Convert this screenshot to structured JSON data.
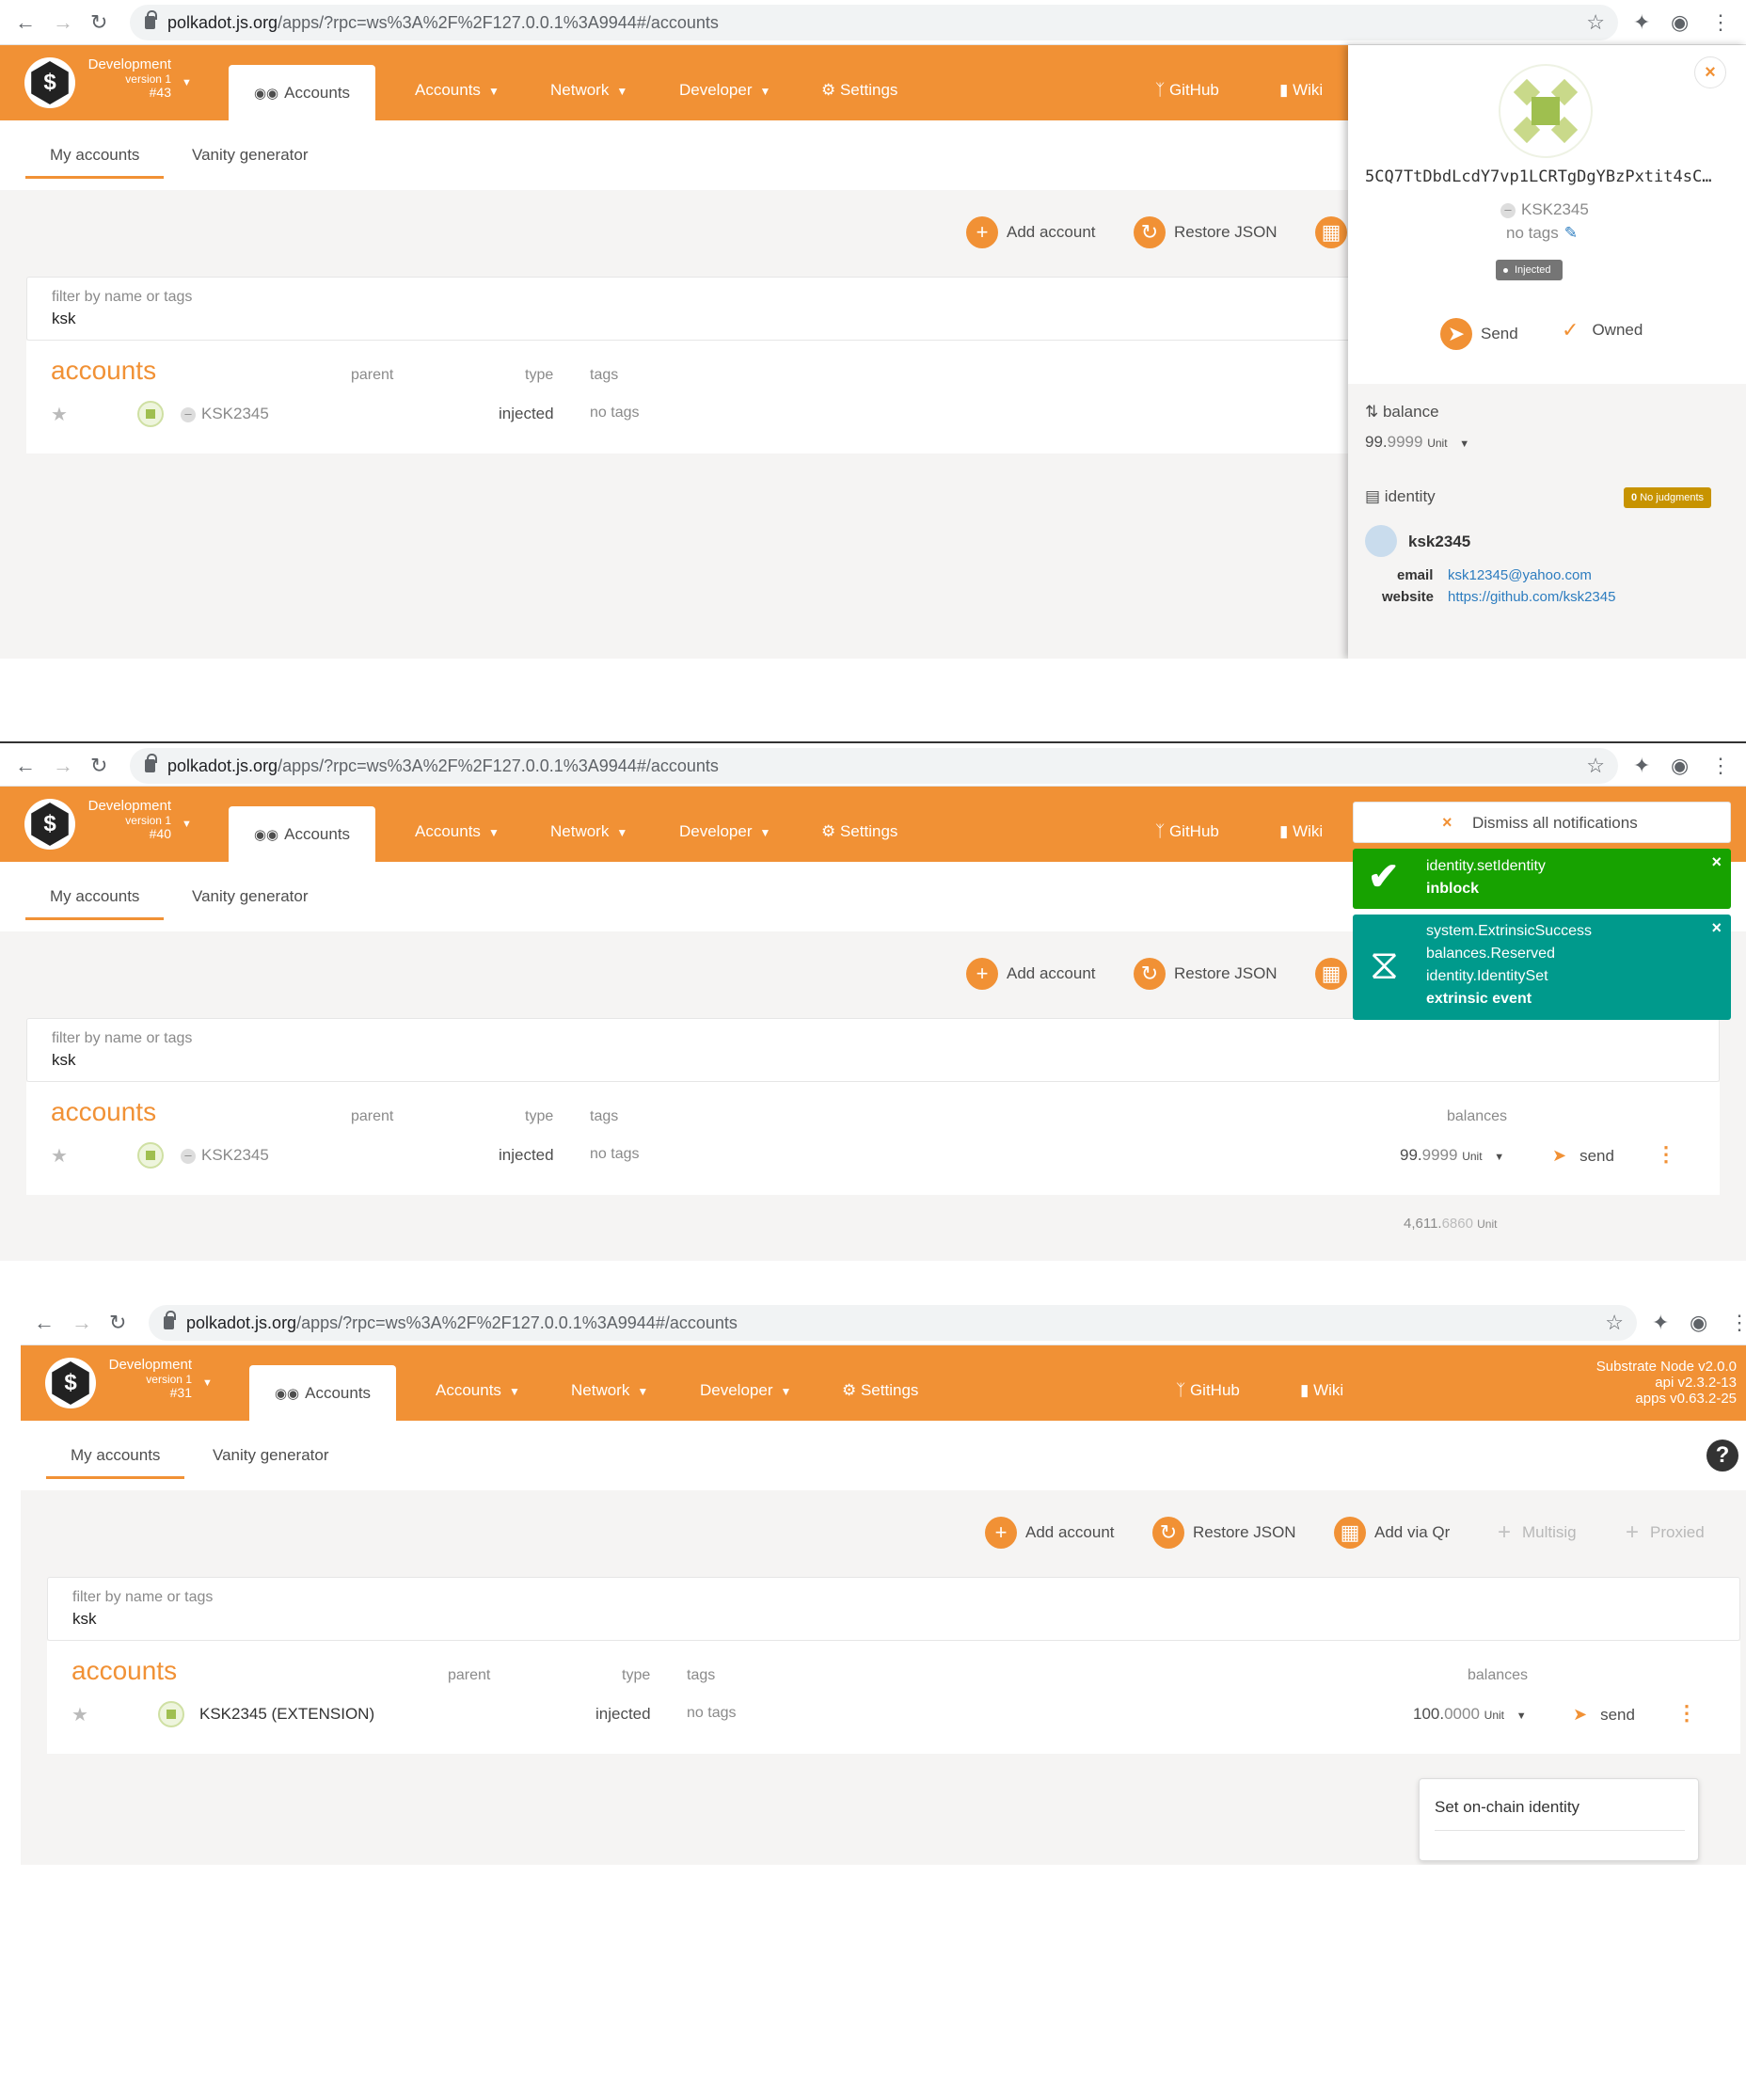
{
  "browser": {
    "url_host": "polkadot.js.org",
    "url_path": "/apps/?rpc=ws%3A%2F%2F127.0.0.1%3A9944#/accounts"
  },
  "nav": {
    "chain_name": "Development",
    "chain_version": "version 1",
    "tab_accounts": "Accounts",
    "menu_accounts": "Accounts",
    "menu_network": "Network",
    "menu_developer": "Developer",
    "menu_settings": "Settings",
    "menu_github": "GitHub",
    "menu_wiki": "Wiki"
  },
  "subtabs": {
    "my_accounts": "My accounts",
    "vanity": "Vanity generator"
  },
  "actions": {
    "add_account": "Add account",
    "restore_json": "Restore JSON",
    "add_via_qr": "Add via Qr",
    "multisig": "Multisig",
    "proxied": "Proxied"
  },
  "filter": {
    "label": "filter by name or tags",
    "value": "ksk"
  },
  "table": {
    "title": "accounts",
    "col_parent": "parent",
    "col_type": "type",
    "col_tags": "tags",
    "col_balances": "balances"
  },
  "panel1": {
    "block": "#43",
    "row": {
      "name": "KSK2345",
      "type": "injected",
      "tags": "no tags"
    },
    "sidebar": {
      "address": "5CQ7TtDbdLcdY7vp1LCRTgDgYBzPxtit4sC…",
      "name": "KSK2345",
      "tags": "no tags",
      "badge": "Injected",
      "send": "Send",
      "owned": "Owned",
      "balance_label": "balance",
      "balance_int": "99.",
      "balance_dec": "9999",
      "balance_unit": "Unit",
      "identity_label": "identity",
      "judgments_count": "0",
      "judgments_text": "No judgments",
      "identity_name": "ksk2345",
      "email_label": "email",
      "email_value": "ksk12345@yahoo.com",
      "website_label": "website",
      "website_value": "https://github.com/ksk2345"
    }
  },
  "panel2": {
    "block": "#40",
    "row": {
      "name": "KSK2345",
      "type": "injected",
      "tags": "no tags",
      "balance_int": "99.",
      "balance_dec": "9999",
      "balance_unit": "Unit",
      "send": "send"
    },
    "total_int": "4,611.",
    "total_dec": "6860",
    "total_unit": "Unit",
    "notifications": {
      "dismiss": "Dismiss all notifications",
      "n1_line1": "identity.setIdentity",
      "n1_line2": "inblock",
      "n2_line1": "system.ExtrinsicSuccess",
      "n2_line2": "balances.Reserved",
      "n2_line3": "identity.IdentitySet",
      "n2_line4": "extrinsic event",
      "n1_color": "#17a200",
      "n2_color": "#009a8c"
    }
  },
  "panel3": {
    "block": "#31",
    "node_version": "Substrate Node v2.0.0",
    "api_version": "api v2.3.2-13",
    "apps_version": "apps v0.63.2-25",
    "row": {
      "name": "KSK2345 (EXTENSION)",
      "type": "injected",
      "tags": "no tags",
      "balance_int": "100.",
      "balance_dec": "0000",
      "balance_unit": "Unit",
      "send": "send"
    },
    "popup_item": "Set on-chain identity"
  },
  "colors": {
    "accent": "#f19135",
    "background": "#f5f4f3"
  }
}
